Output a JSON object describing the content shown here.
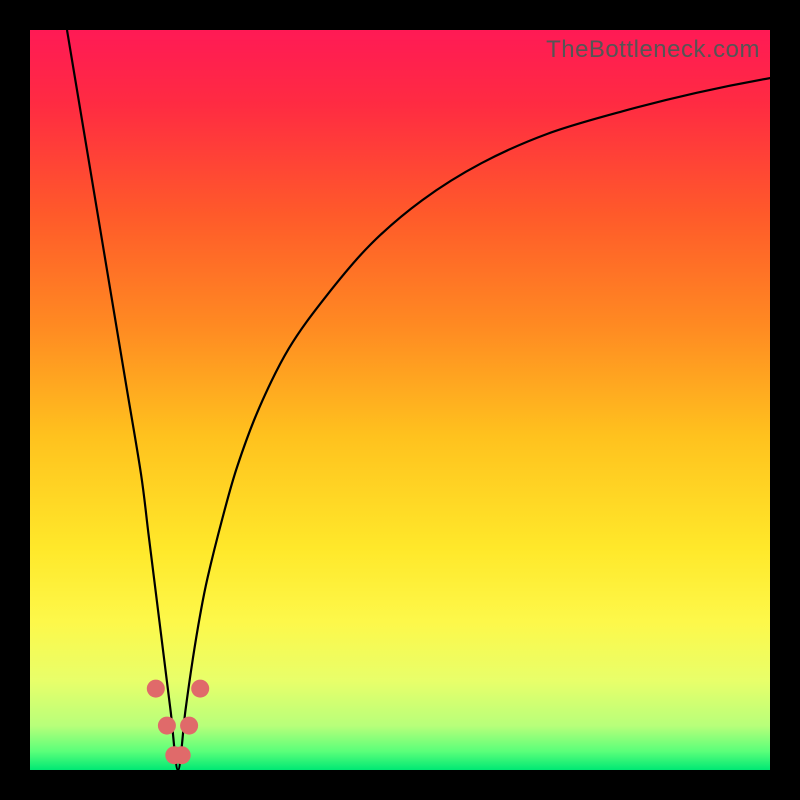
{
  "watermark": "TheBottleneck.com",
  "gradient_stops": [
    {
      "offset": 0.0,
      "color": "#ff1a55"
    },
    {
      "offset": 0.1,
      "color": "#ff2b42"
    },
    {
      "offset": 0.25,
      "color": "#ff5a2a"
    },
    {
      "offset": 0.4,
      "color": "#ff8a22"
    },
    {
      "offset": 0.55,
      "color": "#ffc21e"
    },
    {
      "offset": 0.7,
      "color": "#ffe82a"
    },
    {
      "offset": 0.8,
      "color": "#fdf84a"
    },
    {
      "offset": 0.88,
      "color": "#e8ff6a"
    },
    {
      "offset": 0.94,
      "color": "#b8ff7a"
    },
    {
      "offset": 0.975,
      "color": "#5aff7a"
    },
    {
      "offset": 1.0,
      "color": "#00e874"
    }
  ],
  "marker_color": "#e06a6a",
  "curve_color": "#000000",
  "chart_data": {
    "type": "line",
    "title": "",
    "xlabel": "",
    "ylabel": "",
    "xlim": [
      0,
      100
    ],
    "ylim": [
      0,
      100
    ],
    "notch_x": 20,
    "series": [
      {
        "name": "bottleneck-curve",
        "x": [
          5,
          7,
          9,
          11,
          13,
          15,
          16,
          17,
          18,
          19,
          20,
          21,
          22,
          23,
          24,
          26,
          28,
          31,
          35,
          40,
          46,
          53,
          61,
          70,
          80,
          90,
          100,
          110
        ],
        "y": [
          100,
          88,
          76,
          64,
          52,
          40,
          32,
          24,
          16,
          8,
          0,
          8,
          15,
          21,
          26,
          34,
          41,
          49,
          57,
          64,
          71,
          77,
          82,
          86,
          89,
          91.5,
          93.5,
          95
        ]
      }
    ],
    "markers": [
      {
        "x": 17.0,
        "y": 11
      },
      {
        "x": 18.5,
        "y": 6
      },
      {
        "x": 19.5,
        "y": 2
      },
      {
        "x": 20.5,
        "y": 2
      },
      {
        "x": 21.5,
        "y": 6
      },
      {
        "x": 23.0,
        "y": 11
      }
    ]
  }
}
